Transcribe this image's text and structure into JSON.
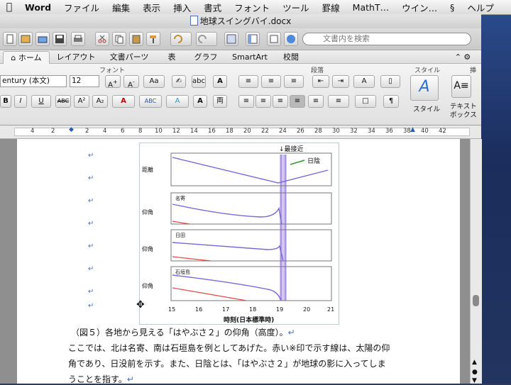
{
  "menubar": {
    "app": "Word",
    "items": [
      "ファイル",
      "編集",
      "表示",
      "挿入",
      "書式",
      "フォント",
      "ツール",
      "罫線",
      "MathT…",
      "ウイン…",
      "ヘルプ"
    ]
  },
  "window": {
    "title": "地球スイングバイ.docx"
  },
  "toolbar": {
    "search_placeholder": "文書内を検索"
  },
  "ribbon_tabs": [
    "ホーム",
    "レイアウト",
    "文書パーツ",
    "表",
    "グラフ",
    "SmartArt",
    "校閲"
  ],
  "ribbon": {
    "group_font": "フォント",
    "group_paragraph": "段落",
    "group_style": "スタイル",
    "group_insert": "挿",
    "font_name": "entury (本文)",
    "font_size": "12",
    "style_label": "スタイル",
    "textbox_label1": "テキスト",
    "textbox_label2": "ボックス"
  },
  "ruler": {
    "ticks": [
      "4",
      "2",
      "2",
      "4",
      "6",
      "8",
      "10",
      "12",
      "14",
      "16",
      "18",
      "20",
      "22",
      "24",
      "26",
      "28",
      "30",
      "32",
      "34",
      "36",
      "38",
      "40",
      "42"
    ]
  },
  "figure": {
    "annotation_closest": "最接近",
    "annotation_eclipse": "日陰",
    "panel_labels": [
      "距離",
      "仰角",
      "仰角",
      "仰角"
    ],
    "panel_tags": [
      "名寄",
      "日田",
      "石垣島"
    ],
    "y_axis_labels": [
      "Dis x 1e5 [km]",
      "El [deg]",
      "El [deg]",
      "El [deg]"
    ],
    "xlabel": "時刻(日本標準時)",
    "x_ticks": [
      "15",
      "16",
      "17",
      "18",
      "19",
      "20",
      "21"
    ]
  },
  "document": {
    "caption": "（図５）各地から見える「はやぶさ２」の仰角（高度）。",
    "body_line1": "ここでは、北は名寄、南は石垣島を例としてあげた。赤い※印で示す線は、太陽の仰",
    "body_line2": "角であり、日没前を示す。また、日陰とは、「はやぶさ２」が地球の影に入ってしま",
    "body_line3": "うことを指す。"
  },
  "colors": {
    "accent": "#4a6fc0",
    "curve": "#7a66d8",
    "sun": "#e04848",
    "shade": "#a78be6"
  }
}
